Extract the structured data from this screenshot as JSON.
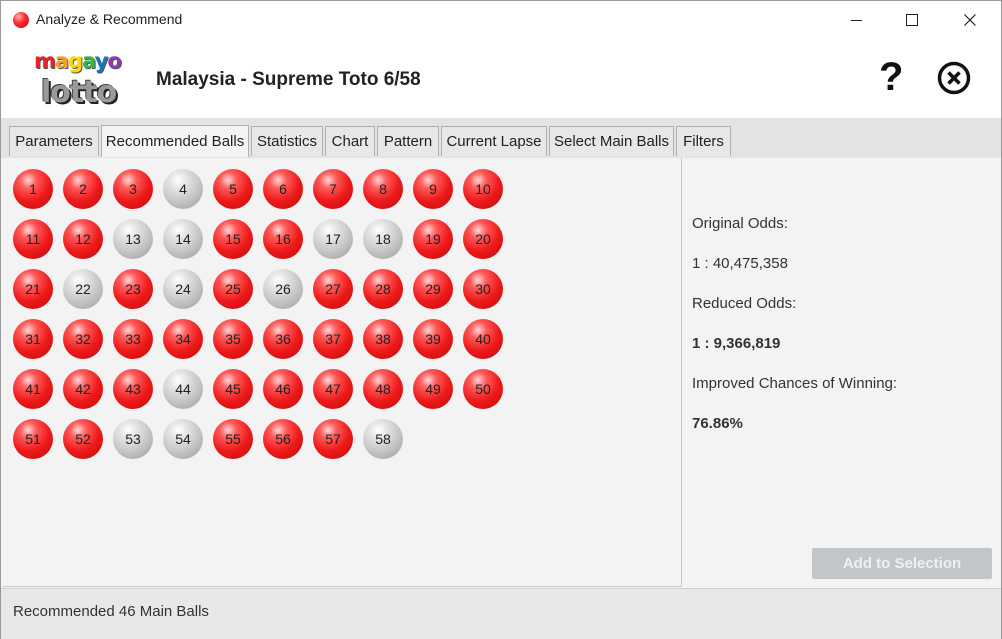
{
  "window": {
    "title": "Analyze & Recommend"
  },
  "header": {
    "logo_top": "magayo",
    "logo_bottom": "lotto",
    "title": "Malaysia - Supreme Toto 6/58",
    "help_glyph": "?"
  },
  "tabs": [
    {
      "label": "Parameters",
      "active": false
    },
    {
      "label": "Recommended Balls",
      "active": true
    },
    {
      "label": "Statistics",
      "active": false
    },
    {
      "label": "Chart",
      "active": false
    },
    {
      "label": "Pattern",
      "active": false
    },
    {
      "label": "Current Lapse",
      "active": false
    },
    {
      "label": "Select Main Balls",
      "active": false
    },
    {
      "label": "Filters",
      "active": false
    }
  ],
  "balls": {
    "total": 58,
    "not_recommended": [
      4,
      13,
      14,
      17,
      18,
      22,
      24,
      26,
      44,
      53,
      54,
      58
    ],
    "colors": {
      "recommended": "#ee1a1a",
      "not_recommended": "#bdbdbd"
    }
  },
  "info": {
    "original_odds_label": "Original Odds:",
    "original_odds_value": "1 : 40,475,358",
    "reduced_odds_label": "Reduced Odds:",
    "reduced_odds_value": "1 : 9,366,819",
    "improved_label": "Improved Chances of Winning:",
    "improved_value": "76.86%"
  },
  "actions": {
    "add_to_selection": "Add to Selection"
  },
  "status": {
    "text": "Recommended 46 Main Balls"
  }
}
